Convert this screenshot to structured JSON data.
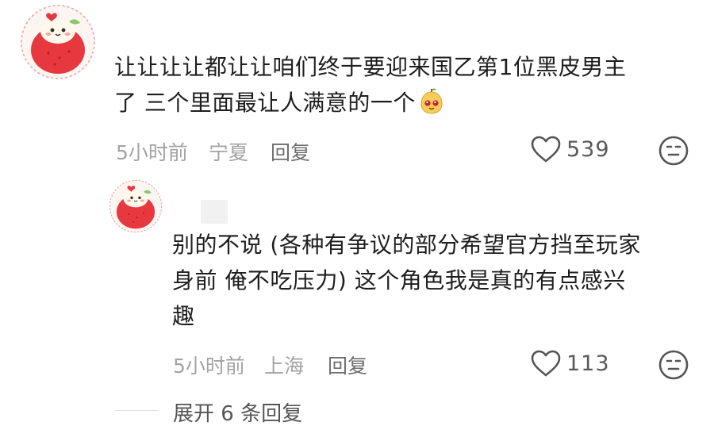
{
  "comment": {
    "text_line1": "让让让让都让让咱们终于要迎来国乙第1位黑皮男主",
    "text_line2": "了 三个里面最让人满意的一个",
    "emoji": "pear-face-emoji",
    "time": "5小时前",
    "location": "宁夏",
    "reply_label": "回复",
    "likes": "539"
  },
  "reply": {
    "text_line1": "别的不说 (各种有争议的部分希望官方挡至玩家",
    "text_line2": "身前 俺不吃压力) 这个角色我是真的有点感兴",
    "text_line3": "趣",
    "time": "5小时前",
    "location": "上海",
    "reply_label": "回复",
    "likes": "113"
  },
  "expand": {
    "label": "展开 6 条回复"
  },
  "colors": {
    "text": "#1e1e1e",
    "meta": "#a3a3a3",
    "avatar_red": "#e8383f"
  }
}
